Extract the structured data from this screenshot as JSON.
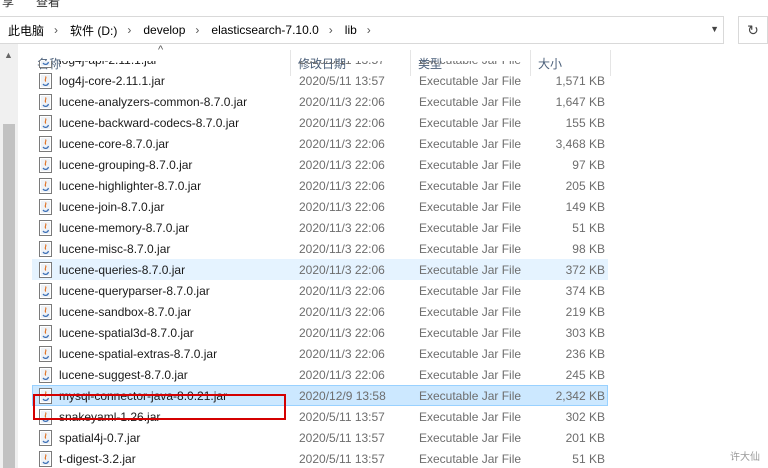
{
  "ribbon": {
    "menu_left": "享",
    "menu_view": "查看"
  },
  "address_bar": {
    "segments": [
      "此电脑",
      "软件 (D:)",
      "develop",
      "elasticsearch-7.10.0",
      "lib"
    ]
  },
  "columns": {
    "name": "名称",
    "modified": "修改日期",
    "type": "类型",
    "size": "大小"
  },
  "files": [
    {
      "name": "log4j-api-2.11.1.jar",
      "date": "2020/5/11 13:57",
      "type": "Executable Jar File",
      "size": ""
    },
    {
      "name": "log4j-core-2.11.1.jar",
      "date": "2020/5/11 13:57",
      "type": "Executable Jar File",
      "size": "1,571 KB"
    },
    {
      "name": "lucene-analyzers-common-8.7.0.jar",
      "date": "2020/11/3 22:06",
      "type": "Executable Jar File",
      "size": "1,647 KB"
    },
    {
      "name": "lucene-backward-codecs-8.7.0.jar",
      "date": "2020/11/3 22:06",
      "type": "Executable Jar File",
      "size": "155 KB"
    },
    {
      "name": "lucene-core-8.7.0.jar",
      "date": "2020/11/3 22:06",
      "type": "Executable Jar File",
      "size": "3,468 KB"
    },
    {
      "name": "lucene-grouping-8.7.0.jar",
      "date": "2020/11/3 22:06",
      "type": "Executable Jar File",
      "size": "97 KB"
    },
    {
      "name": "lucene-highlighter-8.7.0.jar",
      "date": "2020/11/3 22:06",
      "type": "Executable Jar File",
      "size": "205 KB"
    },
    {
      "name": "lucene-join-8.7.0.jar",
      "date": "2020/11/3 22:06",
      "type": "Executable Jar File",
      "size": "149 KB"
    },
    {
      "name": "lucene-memory-8.7.0.jar",
      "date": "2020/11/3 22:06",
      "type": "Executable Jar File",
      "size": "51 KB"
    },
    {
      "name": "lucene-misc-8.7.0.jar",
      "date": "2020/11/3 22:06",
      "type": "Executable Jar File",
      "size": "98 KB"
    },
    {
      "name": "lucene-queries-8.7.0.jar",
      "date": "2020/11/3 22:06",
      "type": "Executable Jar File",
      "size": "372 KB"
    },
    {
      "name": "lucene-queryparser-8.7.0.jar",
      "date": "2020/11/3 22:06",
      "type": "Executable Jar File",
      "size": "374 KB"
    },
    {
      "name": "lucene-sandbox-8.7.0.jar",
      "date": "2020/11/3 22:06",
      "type": "Executable Jar File",
      "size": "219 KB"
    },
    {
      "name": "lucene-spatial3d-8.7.0.jar",
      "date": "2020/11/3 22:06",
      "type": "Executable Jar File",
      "size": "303 KB"
    },
    {
      "name": "lucene-spatial-extras-8.7.0.jar",
      "date": "2020/11/3 22:06",
      "type": "Executable Jar File",
      "size": "236 KB"
    },
    {
      "name": "lucene-suggest-8.7.0.jar",
      "date": "2020/11/3 22:06",
      "type": "Executable Jar File",
      "size": "245 KB"
    },
    {
      "name": "mysql-connector-java-8.0.21.jar",
      "date": "2020/12/9 13:58",
      "type": "Executable Jar File",
      "size": "2,342 KB"
    },
    {
      "name": "snakeyaml-1.26.jar",
      "date": "2020/5/11 13:57",
      "type": "Executable Jar File",
      "size": "302 KB"
    },
    {
      "name": "spatial4j-0.7.jar",
      "date": "2020/5/11 13:57",
      "type": "Executable Jar File",
      "size": "201 KB"
    },
    {
      "name": "t-digest-3.2.jar",
      "date": "2020/5/11 13:57",
      "type": "Executable Jar File",
      "size": "51 KB"
    }
  ],
  "hover_index": 10,
  "selected_index": 16,
  "watermark": "许大仙",
  "colors": {
    "selected_bg": "#cce8ff",
    "hover_bg": "#e5f3ff",
    "highlight_box": "#d40000"
  }
}
